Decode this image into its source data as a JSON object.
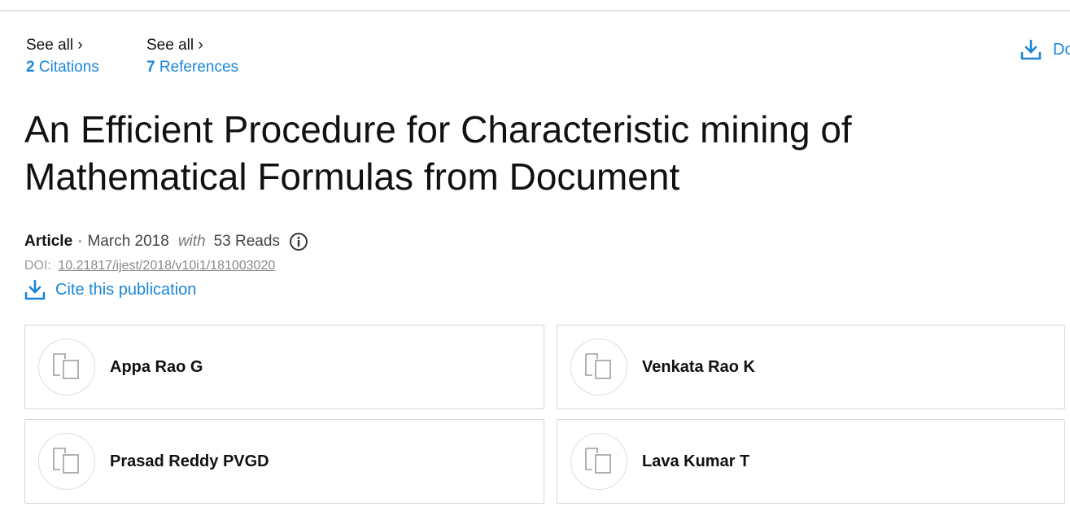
{
  "stats": {
    "citations": {
      "see_all": "See all ›",
      "count": "2",
      "label": "Citations"
    },
    "references": {
      "see_all": "See all ›",
      "count": "7",
      "label": "References"
    }
  },
  "download": {
    "label": "Do",
    "icon": "download-icon"
  },
  "publication": {
    "title": "An Efficient Procedure for Characteristic mining of Mathematical Formulas from Document",
    "type": "Article",
    "separator": "·",
    "date": "March 2018",
    "with_label": "with",
    "reads": "53 Reads",
    "doi_label": "DOI:",
    "doi": "10.21817/ijest/2018/v10i1/181003020",
    "cite_label": "Cite this publication"
  },
  "authors": [
    {
      "name": "Appa Rao G",
      "icon": "author-placeholder-icon"
    },
    {
      "name": "Venkata Rao K",
      "icon": "author-placeholder-icon"
    },
    {
      "name": "Prasad Reddy PVGD",
      "icon": "author-placeholder-icon"
    },
    {
      "name": "Lava Kumar T",
      "icon": "author-placeholder-icon"
    }
  ],
  "colors": {
    "accent": "#1a85d8",
    "text": "#111111",
    "muted": "#9a9a9a",
    "border": "#d6d6d6"
  }
}
